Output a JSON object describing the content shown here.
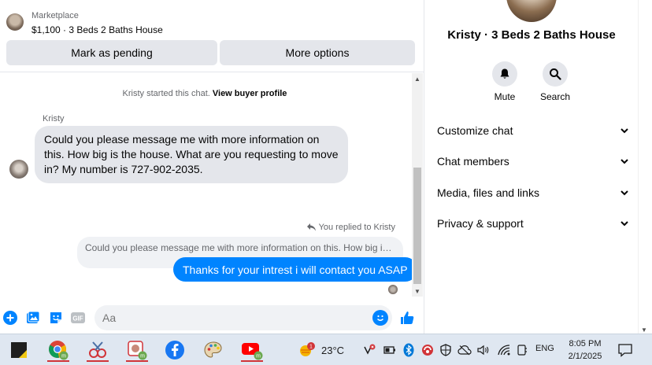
{
  "marketplace": {
    "label": "Marketplace",
    "listing_title": "$1,100 · 3 Beds 2 Baths House",
    "mark_pending": "Mark as pending",
    "more_options": "More options"
  },
  "chat": {
    "started_prefix": "Kristy started this chat.",
    "view_profile": "View buyer profile",
    "sender_name": "Kristy",
    "incoming_message": "Could you please message me with more information on this. How big is the house. What are you requesting to move in? My number is 727-902-2035.",
    "replied_label": "You replied to Kristy",
    "quoted_text": "Could you please message me with more information on this. How big is th...",
    "outgoing_message": "Thanks for your intrest i will contact you ASAP"
  },
  "composer": {
    "placeholder": "Aa"
  },
  "panel": {
    "title": "Kristy · 3 Beds 2 Baths House",
    "mute_label": "Mute",
    "search_label": "Search",
    "sections": [
      "Customize chat",
      "Chat members",
      "Media, files and links",
      "Privacy & support"
    ]
  },
  "taskbar": {
    "temperature": "23°C",
    "language": "ENG",
    "time": "8:05 PM",
    "date": "2/1/2025",
    "weather_badge": "1"
  },
  "colors": {
    "accent": "#0084ff",
    "bubble_gray": "#e4e6eb",
    "taskbar": "#dfe7f1"
  }
}
